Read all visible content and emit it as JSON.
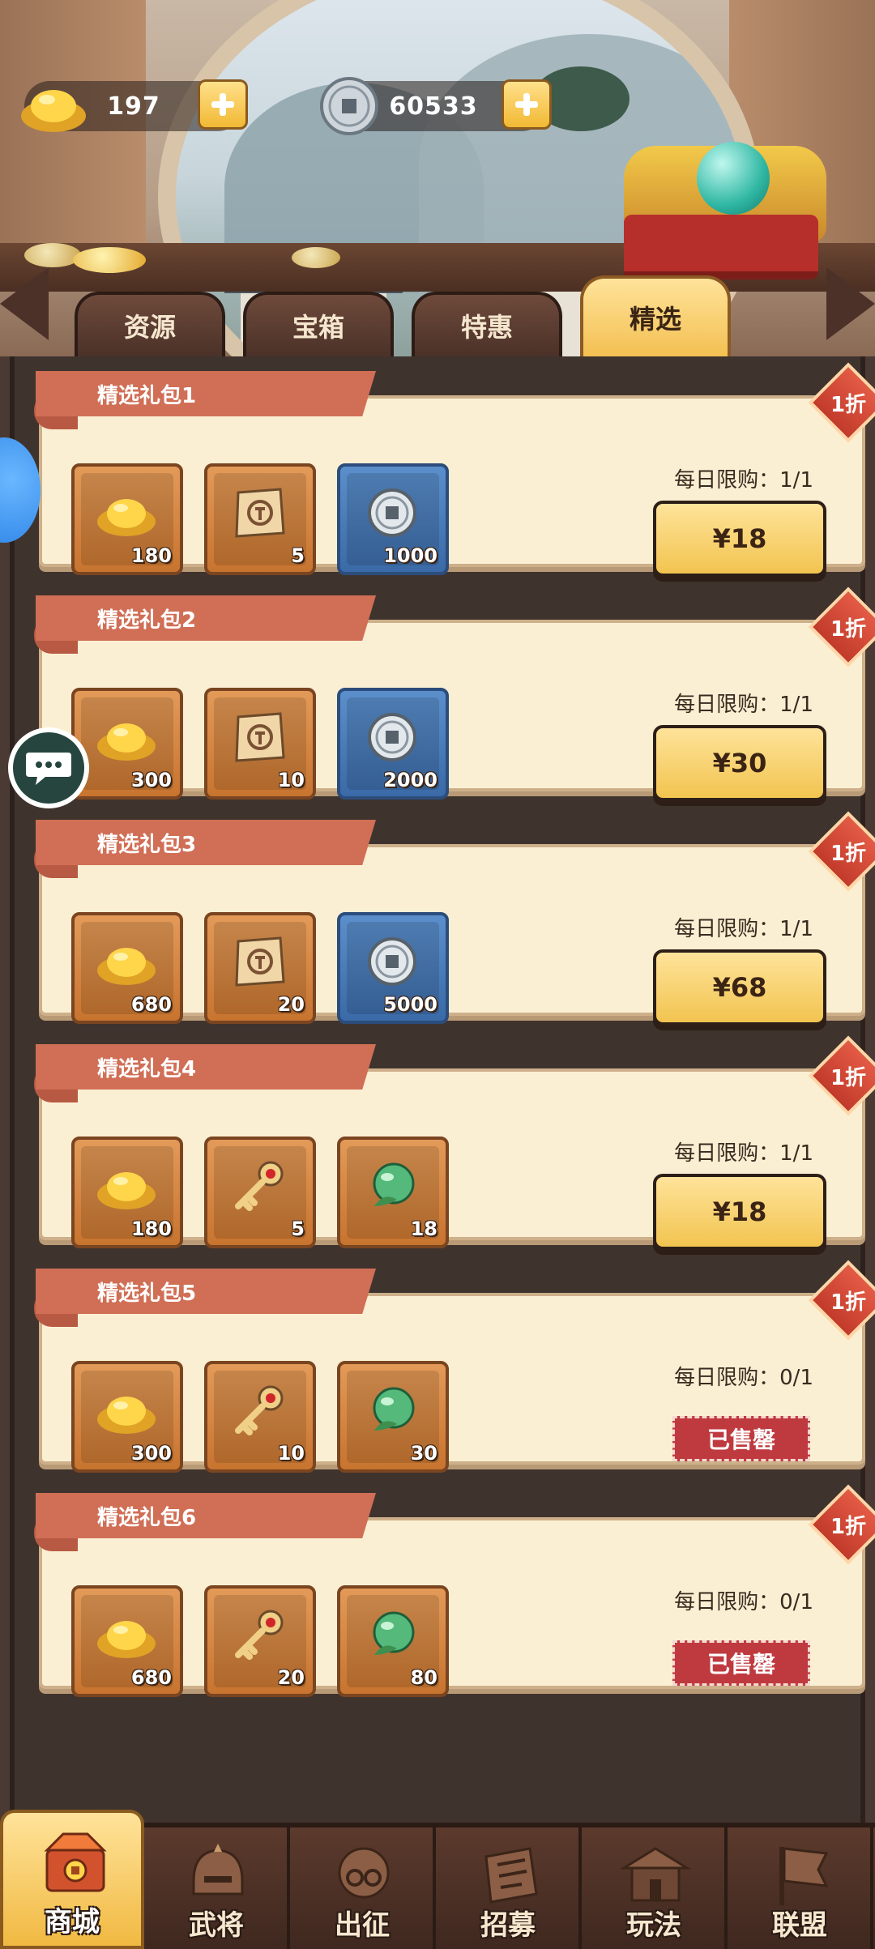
{
  "currencies": {
    "gold": {
      "value": "197",
      "icon": "gold-ingot-icon"
    },
    "silver": {
      "value": "60533",
      "icon": "silver-coin-icon"
    }
  },
  "tabs": [
    {
      "label": "资源",
      "active": false
    },
    {
      "label": "宝箱",
      "active": false
    },
    {
      "label": "特惠",
      "active": false
    },
    {
      "label": "精选",
      "active": true
    }
  ],
  "packs": [
    {
      "title": "精选礼包1",
      "discount": "1折",
      "limit": "每日限购：1/1",
      "price": "¥18",
      "sold_out": false,
      "items": [
        {
          "icon": "gold-ingot-icon",
          "qty": "180"
        },
        {
          "icon": "token-scroll-icon",
          "qty": "5"
        },
        {
          "icon": "silver-coin-icon",
          "qty": "1000"
        }
      ]
    },
    {
      "title": "精选礼包2",
      "discount": "1折",
      "limit": "每日限购：1/1",
      "price": "¥30",
      "sold_out": false,
      "items": [
        {
          "icon": "gold-ingot-icon",
          "qty": "300"
        },
        {
          "icon": "token-scroll-icon",
          "qty": "10"
        },
        {
          "icon": "silver-coin-icon",
          "qty": "2000"
        }
      ]
    },
    {
      "title": "精选礼包3",
      "discount": "1折",
      "limit": "每日限购：1/1",
      "price": "¥68",
      "sold_out": false,
      "items": [
        {
          "icon": "gold-ingot-icon",
          "qty": "680"
        },
        {
          "icon": "token-scroll-icon",
          "qty": "20"
        },
        {
          "icon": "silver-coin-icon",
          "qty": "5000"
        }
      ]
    },
    {
      "title": "精选礼包4",
      "discount": "1折",
      "limit": "每日限购：1/1",
      "price": "¥18",
      "sold_out": false,
      "items": [
        {
          "icon": "gold-ingot-icon",
          "qty": "180"
        },
        {
          "icon": "ruby-key-icon",
          "qty": "5"
        },
        {
          "icon": "jade-orb-icon",
          "qty": "18"
        }
      ]
    },
    {
      "title": "精选礼包5",
      "discount": "1折",
      "limit": "每日限购：0/1",
      "sold_out_label": "已售罄",
      "sold_out": true,
      "items": [
        {
          "icon": "gold-ingot-icon",
          "qty": "300"
        },
        {
          "icon": "ruby-key-icon",
          "qty": "10"
        },
        {
          "icon": "jade-orb-icon",
          "qty": "30"
        }
      ]
    },
    {
      "title": "精选礼包6",
      "discount": "1折",
      "limit": "每日限购：0/1",
      "sold_out_label": "已售罄",
      "sold_out": true,
      "items": [
        {
          "icon": "gold-ingot-icon",
          "qty": "680"
        },
        {
          "icon": "ruby-key-icon",
          "qty": "20"
        },
        {
          "icon": "jade-orb-icon",
          "qty": "80"
        }
      ]
    }
  ],
  "bottom_nav": [
    {
      "label": "商城",
      "icon": "shop-chest-icon",
      "active": true
    },
    {
      "label": "武将",
      "icon": "general-helmet-icon",
      "active": false
    },
    {
      "label": "出征",
      "icon": "expedition-icon",
      "active": false
    },
    {
      "label": "招募",
      "icon": "recruit-scroll-icon",
      "active": false
    },
    {
      "label": "玩法",
      "icon": "pavilion-icon",
      "active": false
    },
    {
      "label": "联盟",
      "icon": "alliance-flag-icon",
      "active": false
    }
  ],
  "colors": {
    "accent_gold": "#f2c450",
    "ribbon": "#d06f56",
    "soldout": "#bf3a3f",
    "card": "#fbefd3"
  }
}
